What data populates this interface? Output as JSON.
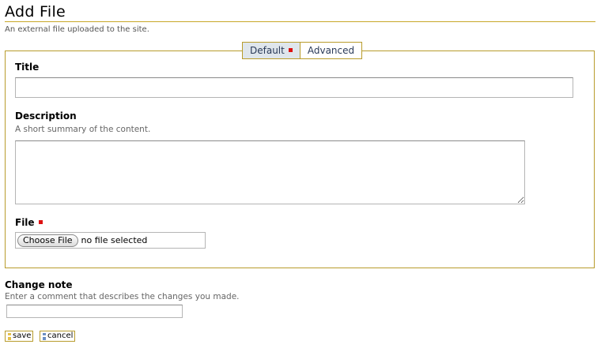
{
  "header": {
    "title": "Add File",
    "description": "An external file uploaded to the site."
  },
  "tabs": [
    {
      "label": "Default",
      "selected": true,
      "required": true
    },
    {
      "label": "Advanced",
      "selected": false,
      "required": false
    }
  ],
  "fields": {
    "title": {
      "label": "Title",
      "value": ""
    },
    "description": {
      "label": "Description",
      "help": "A short summary of the content.",
      "value": ""
    },
    "file": {
      "label": "File",
      "required": true,
      "button_label": "Choose File",
      "status": "no file selected"
    }
  },
  "change_note": {
    "label": "Change note",
    "help": "Enter a comment that describes the changes you made.",
    "value": ""
  },
  "buttons": {
    "save": "save",
    "cancel": "cancel"
  },
  "colors": {
    "border_accent": "#b89c2c",
    "required_marker": "#dd1111",
    "selected_tab_bg": "#dfe6ec"
  }
}
